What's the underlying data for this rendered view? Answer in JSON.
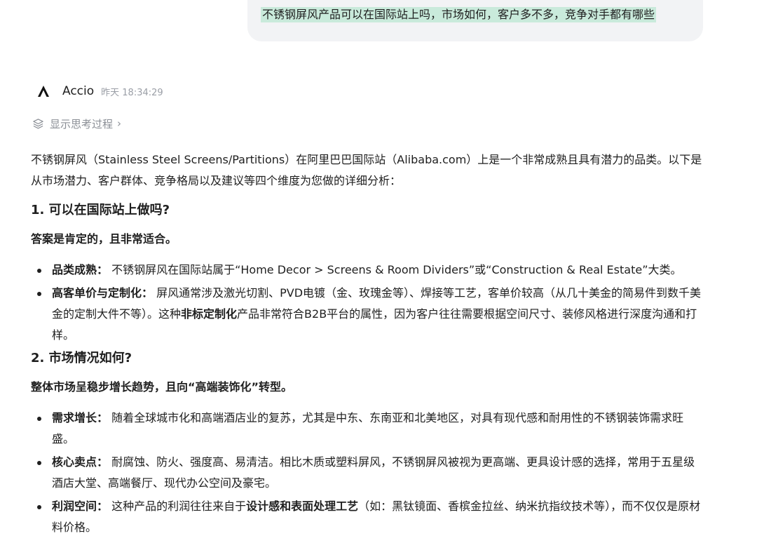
{
  "user_message": {
    "text": "不锈钢屏风产品可以在国际站上吗，市场如何，客户多不多，竞争对手都有哪些"
  },
  "assistant": {
    "name": "Accio",
    "timestamp": "昨天 18:34:29",
    "logo_icon": "accio-logo-icon",
    "thinking_toggle_label": "显示思考过程",
    "thinking_icon": "layers-icon",
    "chevron": "›"
  },
  "answer": {
    "intro": "不锈钢屏风（Stainless Steel Screens/Partitions）在阿里巴巴国际站（Alibaba.com）上是一个非常成熟且具有潜力的品类。以下是从市场潜力、客户群体、竞争格局以及建议等四个维度为您做的详细分析：",
    "section1": {
      "heading": "1. 可以在国际站上做吗?",
      "lead": "答案是肯定的，且非常适合。",
      "bullets": [
        {
          "label": "品类成熟：",
          "text": "不锈钢屏风在国际站属于“Home Decor > Screens & Room Dividers”或“Construction & Real Estate”大类。"
        },
        {
          "label": "高客单价与定制化：",
          "text_before": "屏风通常涉及激光切割、PVD电镀（金、玫瑰金等）、焊接等工艺，客单价较高（从几十美金的简易件到数千美金的定制大件不等）。这种",
          "bold_mid": "非标定制化",
          "text_after": "产品非常符合B2B平台的属性，因为客户往往需要根据空间尺寸、装修风格进行深度沟通和打样。"
        }
      ]
    },
    "section2": {
      "heading": "2. 市场情况如何?",
      "lead": "整体市场呈稳步增长趋势，且向“高端装饰化”转型。",
      "bullets": [
        {
          "label": "需求增长：",
          "text": "随着全球城市化和高端酒店业的复苏，尤其是中东、东南亚和北美地区，对具有现代感和耐用性的不锈钢装饰需求旺盛。"
        },
        {
          "label": "核心卖点：",
          "text": "耐腐蚀、防火、强度高、易清洁。相比木质或塑料屏风，不锈钢屏风被视为更高端、更具设计感的选择，常用于五星级酒店大堂、高端餐厅、现代办公空间及豪宅。"
        },
        {
          "label": "利润空间：",
          "text_before": "这种产品的利润往往来自于",
          "bold_mid": "设计感和表面处理工艺",
          "text_after": "（如：黑钛镜面、香槟金拉丝、纳米抗指纹技术等），而不仅仅是原材料价格。"
        }
      ]
    }
  }
}
